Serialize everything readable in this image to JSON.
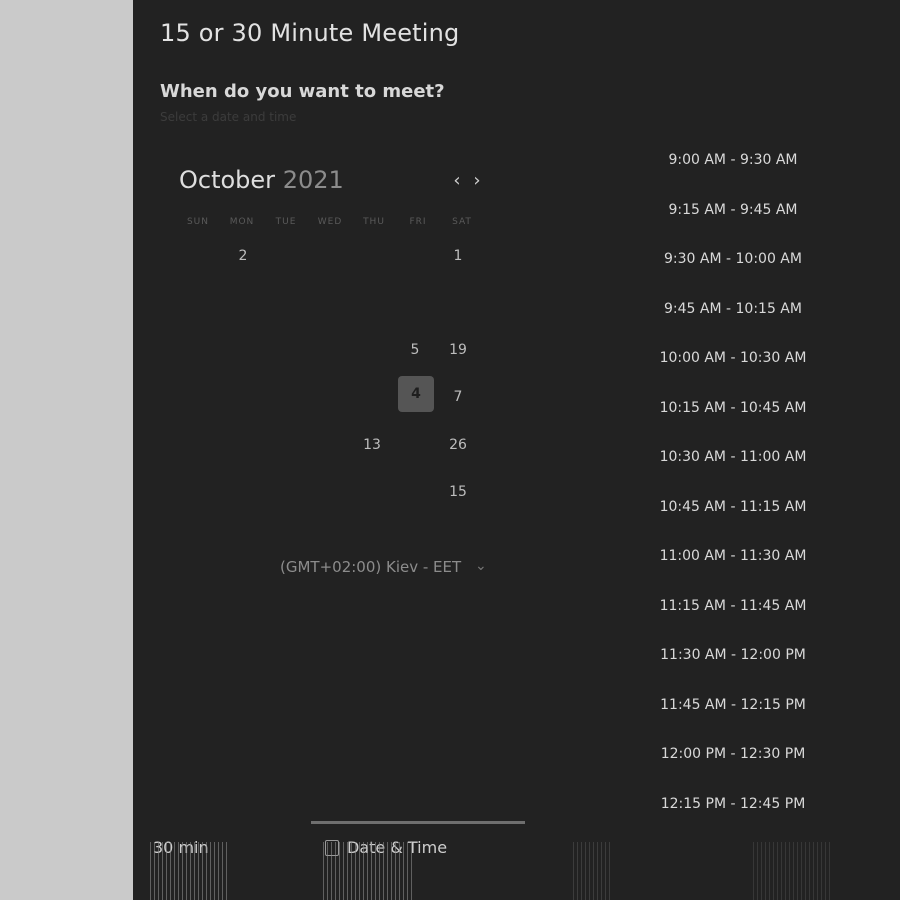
{
  "header": {
    "title": "15 or 30 Minute Meeting"
  },
  "prompt": {
    "heading": "When do you want to meet?",
    "subheading": "Select a date and time"
  },
  "calendar": {
    "month": "October",
    "year": "2021",
    "prev_icon": "chevron-left-icon",
    "next_icon": "chevron-right-icon",
    "weekdays": [
      "SUN",
      "MON",
      "TUE",
      "WED",
      "THU",
      "FRI",
      "SAT"
    ],
    "visible_days": [
      "2",
      "1",
      "5",
      "19",
      "4",
      "7",
      "13",
      "26",
      "15"
    ],
    "selected_day": "4"
  },
  "timezone": {
    "label": "(GMT+02:00) Kiev - EET",
    "icon": "chevron-down-icon"
  },
  "time_slots": [
    "9:00 AM - 9:30 AM",
    "9:15 AM - 9:45 AM",
    "9:30 AM - 10:00 AM",
    "9:45 AM - 10:15 AM",
    "10:00 AM - 10:30 AM",
    "10:15 AM - 10:45 AM",
    "10:30 AM - 11:00 AM",
    "10:45 AM - 11:15 AM",
    "11:00 AM - 11:30 AM",
    "11:15 AM - 11:45 AM",
    "11:30 AM - 12:00 PM",
    "11:45 AM - 12:15 PM",
    "12:00 PM - 12:30 PM",
    "12:15 PM - 12:45 PM"
  ],
  "steps": {
    "duration_label": "30 min",
    "datetime_label": "Date & Time"
  },
  "colors": {
    "panel_background": "#222222",
    "outer_background": "#cacaca",
    "selected_day_background": "#555555"
  }
}
